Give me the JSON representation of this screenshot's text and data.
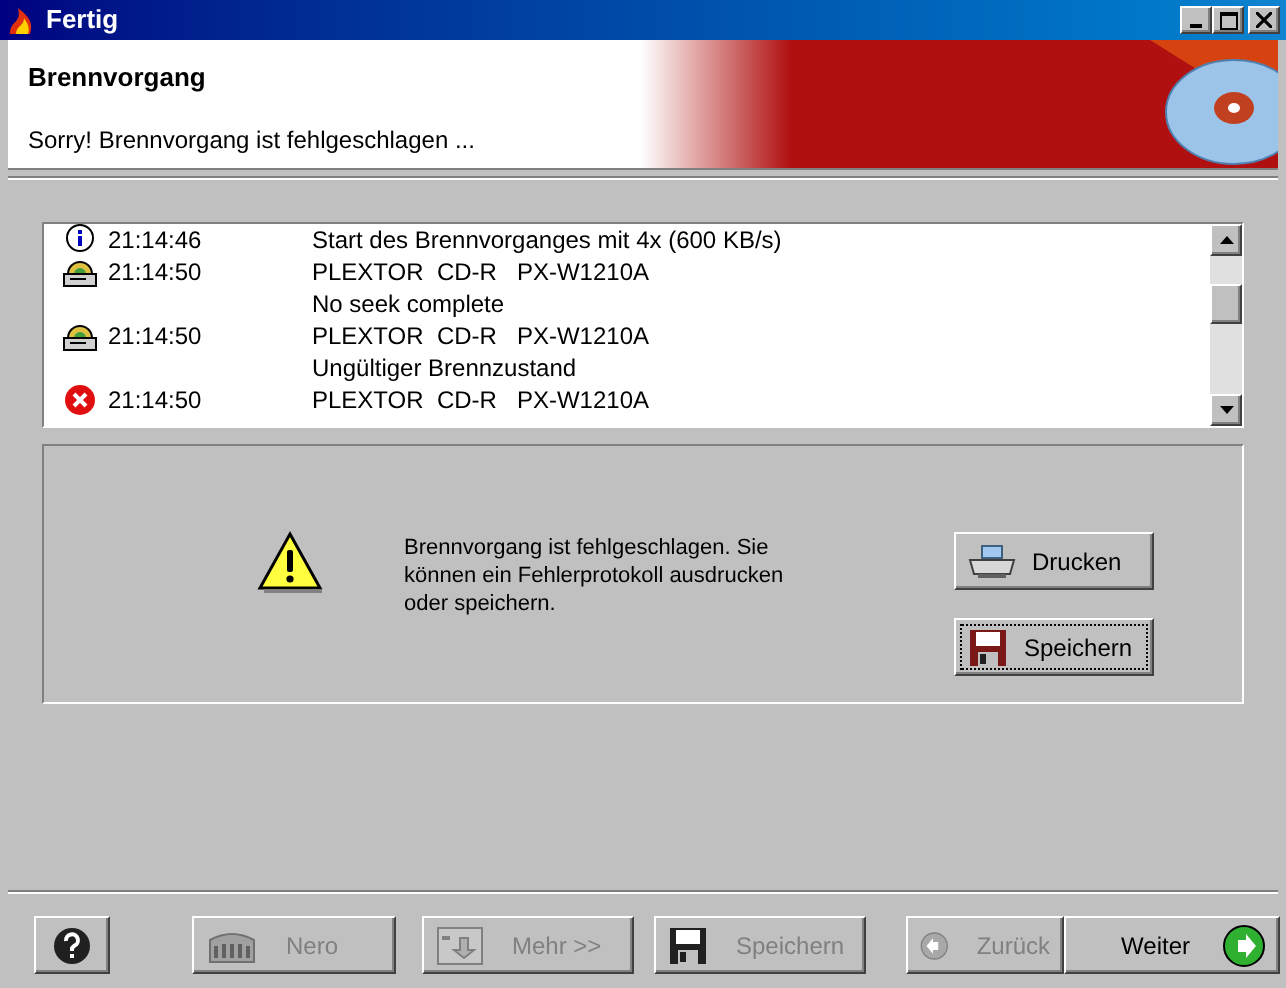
{
  "window": {
    "title": "Fertig"
  },
  "header": {
    "title": "Brennvorgang",
    "subtitle": "Sorry! Brennvorgang ist fehlgeschlagen ..."
  },
  "log": {
    "rows": [
      {
        "kind": "info",
        "time": "21:14:46",
        "message": "Start des Brennvorganges mit 4x (600 KB/s)"
      },
      {
        "kind": "drive",
        "time": "21:14:50",
        "message": "PLEXTOR  CD-R   PX-W1210A"
      },
      {
        "kind": "text",
        "message": "No seek complete"
      },
      {
        "kind": "drive",
        "time": "21:14:50",
        "message": "PLEXTOR  CD-R   PX-W1210A"
      },
      {
        "kind": "text",
        "message": "Ungültiger Brennzustand"
      },
      {
        "kind": "error",
        "time": "21:14:50",
        "message": "PLEXTOR  CD-R   PX-W1210A"
      }
    ]
  },
  "notice": {
    "message": "Brennvorgang ist fehlgeschlagen. Sie können ein Fehlerprotokoll ausdrucken oder speichern.",
    "buttons": [
      {
        "kind": "print",
        "label": "Drucken",
        "focused": false
      },
      {
        "kind": "save",
        "label": "Speichern",
        "focused": true
      }
    ]
  },
  "footer": {
    "buttons": [
      {
        "kind": "help",
        "disabled": false
      },
      {
        "kind": "nero",
        "label": "Nero",
        "disabled": true
      },
      {
        "kind": "more",
        "label": "Mehr >>",
        "disabled": true
      },
      {
        "kind": "save",
        "label": "Speichern",
        "disabled": true
      },
      {
        "kind": "back",
        "label": "Zurück",
        "disabled": true
      },
      {
        "kind": "next",
        "label": "Weiter",
        "disabled": false
      }
    ]
  }
}
